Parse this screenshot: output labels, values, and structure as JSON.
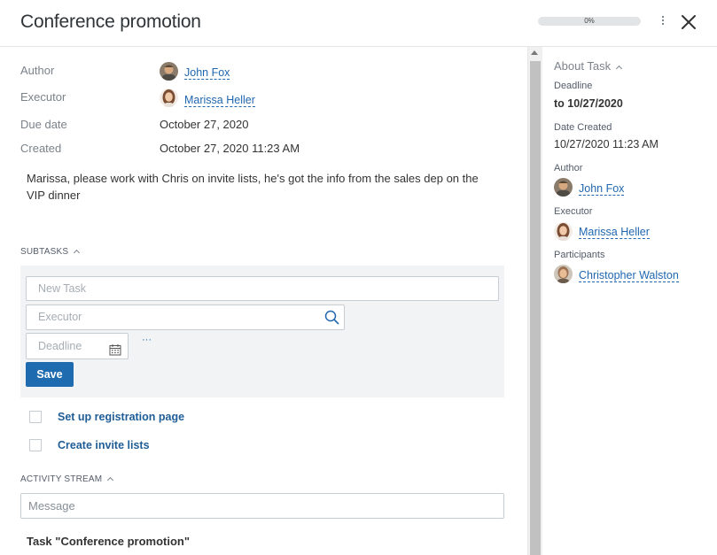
{
  "header": {
    "title": "Conference promotion",
    "progress_text": "0%",
    "progress_value": 0,
    "more_icon": "more-vertical-icon",
    "close_icon": "close-icon"
  },
  "fields": {
    "author_label": "Author",
    "author_name": "John Fox",
    "executor_label": "Executor",
    "executor_name": "Marissa Heller",
    "due_label": "Due date",
    "due_value": "October 27, 2020",
    "created_label": "Created",
    "created_value": "October 27, 2020 11:23 AM"
  },
  "description": "Marissa, please work with Chris on invite lists, he's got the info from the sales dep on the VIP dinner",
  "subtasks": {
    "title": "SUBTASKS",
    "new_task_placeholder": "New Task",
    "executor_placeholder": "Executor",
    "deadline_placeholder": "Deadline",
    "more": "···",
    "save_label": "Save",
    "items": [
      {
        "label": "Set up registration page"
      },
      {
        "label": "Create invite lists"
      }
    ]
  },
  "activity": {
    "title": "ACTIVITY STREAM",
    "message_placeholder": "Message",
    "task_title": "Task \"Conference promotion\""
  },
  "side": {
    "about_title": "About Task",
    "deadline_label": "Deadline",
    "deadline_value": "to 10/27/2020",
    "date_created_label": "Date Created",
    "date_created_value": "10/27/2020 11:23 AM",
    "author_label": "Author",
    "author_name": "John Fox",
    "executor_label": "Executor",
    "executor_name": "Marissa Heller",
    "participants_label": "Participants",
    "participant_name": "Christopher Walston"
  },
  "colors": {
    "accent": "#1f6bb0",
    "link": "#2067b0",
    "progress": "#5fa8d3"
  }
}
